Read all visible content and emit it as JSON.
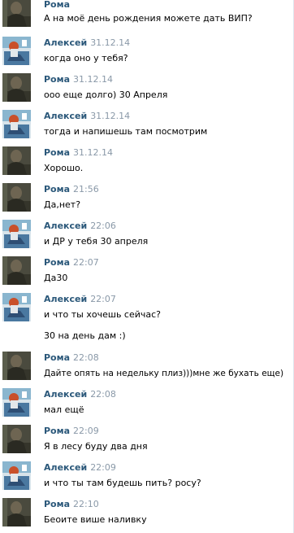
{
  "messages": [
    {
      "kind": "roma",
      "author": "Рома",
      "time": "",
      "text": "А на моё день рождения можете дать ВИП?"
    },
    {
      "kind": "alexey",
      "author": "Алексей",
      "time": "31.12.14",
      "text": "когда оно у тебя?"
    },
    {
      "kind": "roma",
      "author": "Рома",
      "time": "31.12.14",
      "text": "ооо еще долго) 30 Апреля"
    },
    {
      "kind": "alexey",
      "author": "Алексей",
      "time": "31.12.14",
      "text": "тогда и напишешь там посмотрим"
    },
    {
      "kind": "roma",
      "author": "Рома",
      "time": "31.12.14",
      "text": "Хорошо."
    },
    {
      "kind": "roma",
      "author": "Рома",
      "time": "21:56",
      "text": "Да,нет?"
    },
    {
      "kind": "alexey",
      "author": "Алексей",
      "time": "22:06",
      "text": "и ДР у тебя 30 апреля"
    },
    {
      "kind": "roma",
      "author": "Рома",
      "time": "22:07",
      "text": "Да30"
    },
    {
      "kind": "alexey",
      "author": "Алексей",
      "time": "22:07",
      "text": "и что ты хочешь сейчас?"
    },
    {
      "kind": "continuation",
      "author": "",
      "time": "",
      "text": "30 на день дам :)"
    },
    {
      "kind": "roma",
      "author": "Рома",
      "time": "22:08",
      "text": "Дайте опять на недельку плиз)))мне же бухать еще)"
    },
    {
      "kind": "alexey",
      "author": "Алексей",
      "time": "22:08",
      "text": "мал ещё"
    },
    {
      "kind": "roma",
      "author": "Рома",
      "time": "22:09",
      "text": "Я в лесу буду два дня"
    },
    {
      "kind": "alexey",
      "author": "Алексей",
      "time": "22:09",
      "text": "и что ты там будешь пить? росу?"
    },
    {
      "kind": "roma",
      "author": "Рома",
      "time": "22:10",
      "text": "Беоите више наливку"
    }
  ]
}
